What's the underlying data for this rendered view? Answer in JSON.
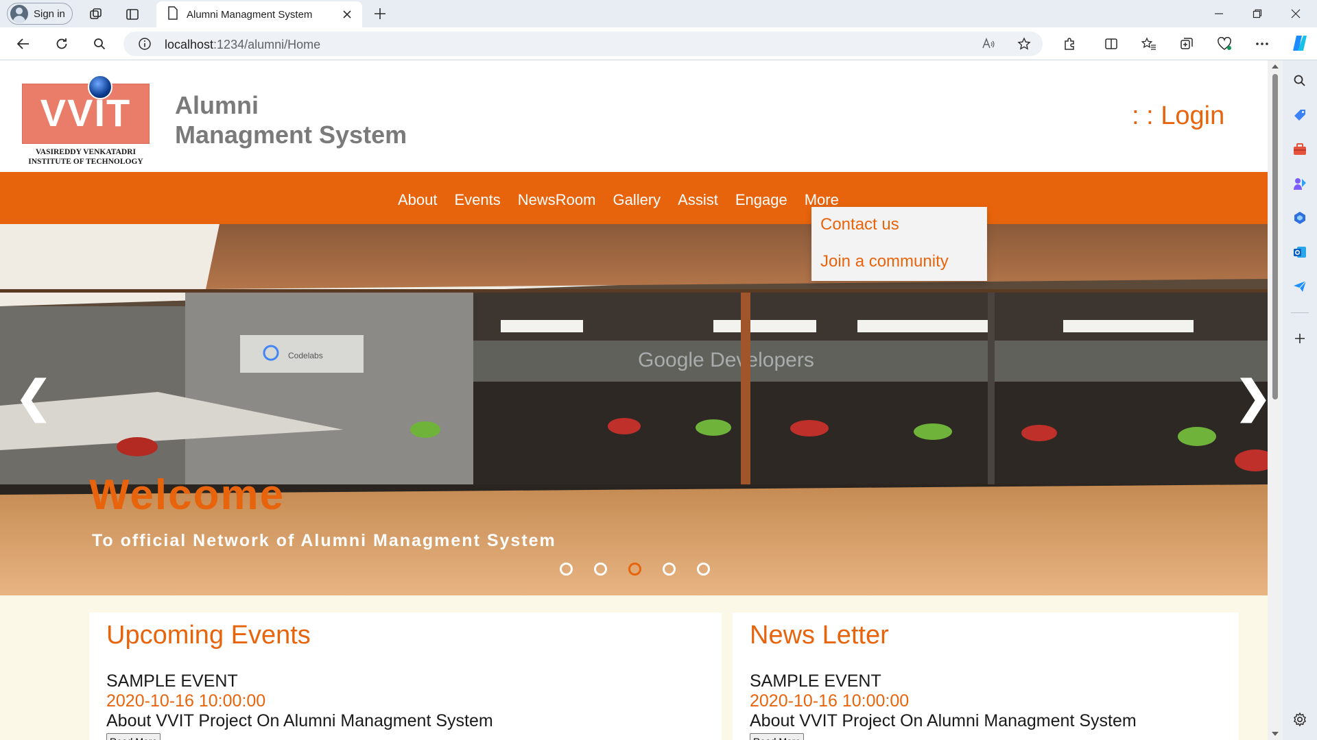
{
  "browser": {
    "profile_label": "Sign in",
    "tab_title": "Alumni Managment System",
    "url_host": "localhost",
    "url_path": ":1234/alumni/Home"
  },
  "header": {
    "logo_text": "VVIT",
    "logo_subtitle": "VASIREDDY VENKATADRI INSTITUTE OF TECHNOLOGY",
    "title_line1": "Alumni",
    "title_line2": "Managment System",
    "login": ": : Login"
  },
  "nav": {
    "items": [
      "About",
      "Events",
      "NewsRoom",
      "Gallery",
      "Assist",
      "Engage",
      "More"
    ]
  },
  "dropdown": {
    "items": [
      "Contact us",
      "Join a community"
    ]
  },
  "hero": {
    "heading": "Welcome",
    "tagline": "To official Network of Alumni Managment System",
    "prev": "❮",
    "next": "❯",
    "slide_count": 5,
    "active_slide": 3,
    "wall_sign": "Google Developers",
    "sign_text": "Codelabs"
  },
  "events": {
    "title": "Upcoming Events",
    "item_title": "SAMPLE EVENT",
    "item_date": "2020-10-16 10:00:00",
    "item_desc": "About VVIT Project On Alumni Managment System",
    "button": "Read More"
  },
  "newsletter": {
    "title": "News Letter",
    "item_title": "SAMPLE EVENT",
    "item_date": "2020-10-16 10:00:00",
    "item_desc": "About VVIT Project On Alumni Managment System",
    "button": "Read More"
  },
  "colors": {
    "brand_orange": "#e8640c",
    "header_gray": "#7a7a7a",
    "content_bg": "#fbf8e8"
  }
}
